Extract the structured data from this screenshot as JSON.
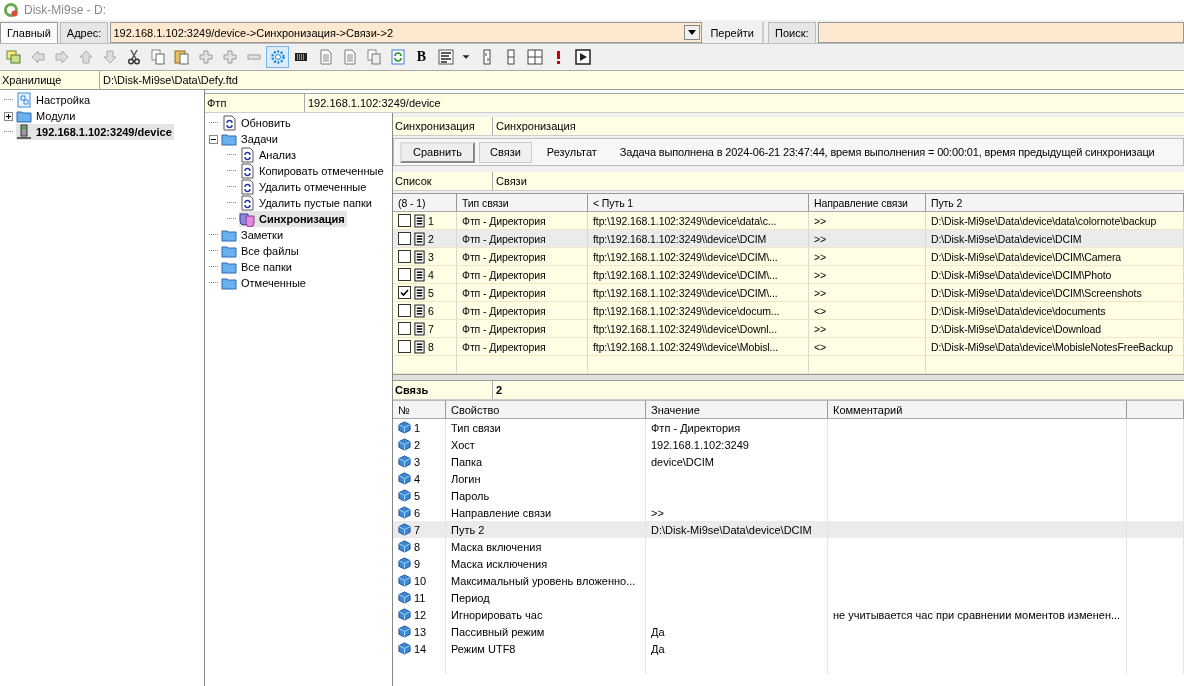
{
  "window": {
    "title": "Disk-Mi9se - D:"
  },
  "tabs": [
    {
      "label": "Главный",
      "selected": true
    }
  ],
  "address": {
    "label": "Адрес:",
    "value": "192.168.1.102:3249/device->Синхронизация->Связи->2"
  },
  "go_button": "Перейти",
  "search": {
    "label": "Поиск:"
  },
  "toolbar": [
    {
      "kind": "new-window",
      "selected": false
    },
    {
      "kind": "back",
      "selected": false
    },
    {
      "kind": "forward",
      "selected": false
    },
    {
      "kind": "up",
      "selected": false
    },
    {
      "kind": "down",
      "selected": false
    },
    {
      "kind": "cut",
      "selected": false
    },
    {
      "kind": "copy",
      "selected": false
    },
    {
      "kind": "paste",
      "selected": false
    },
    {
      "kind": "plus",
      "selected": false
    },
    {
      "kind": "plus",
      "selected": false
    },
    {
      "kind": "minus",
      "selected": false
    },
    {
      "kind": "gear",
      "selected": true
    },
    {
      "kind": "keyboard",
      "selected": false
    },
    {
      "kind": "doc",
      "selected": false
    },
    {
      "kind": "doc",
      "selected": false
    },
    {
      "kind": "doc-copy",
      "selected": false
    },
    {
      "kind": "refresh",
      "selected": false
    },
    {
      "kind": "bold",
      "label": "B",
      "selected": false
    },
    {
      "kind": "align",
      "selected": false
    },
    {
      "kind": "dropdown",
      "selected": false
    },
    {
      "kind": "split-v",
      "selected": false
    },
    {
      "kind": "split-h",
      "selected": false
    },
    {
      "kind": "split-quad",
      "selected": false
    },
    {
      "kind": "alert",
      "selected": false
    },
    {
      "kind": "play",
      "selected": false
    }
  ],
  "storage": {
    "label": "Хранилище",
    "value": "D:\\Disk-Mi9se\\Data\\Defy.ftd"
  },
  "left_tree": [
    {
      "label": "Настройка",
      "kind": "settings",
      "selected": false
    },
    {
      "label": "Модули",
      "kind": "folder",
      "expanded": false,
      "selected": false
    },
    {
      "label": "192.168.1.102:3249/device",
      "kind": "computer",
      "selected": true
    }
  ],
  "middle_header": {
    "label": "Фтп",
    "value": "192.168.1.102:3249/device"
  },
  "middle_tree": [
    {
      "label": "Обновить",
      "kind": "task",
      "selected": false
    },
    {
      "label": "Задачи",
      "kind": "folder",
      "expanded": true,
      "selected": false,
      "children": [
        {
          "label": "Анализ",
          "kind": "task",
          "selected": false
        },
        {
          "label": "Копировать отмеченные",
          "kind": "task",
          "selected": false
        },
        {
          "label": "Удалить отмеченные",
          "kind": "task",
          "selected": false
        },
        {
          "label": "Удалить пустые папки",
          "kind": "task",
          "selected": false
        },
        {
          "label": "Синхронизация",
          "kind": "sync",
          "selected": true
        }
      ]
    },
    {
      "label": "Заметки",
      "kind": "folder",
      "selected": false
    },
    {
      "label": "Все файлы",
      "kind": "folder",
      "selected": false
    },
    {
      "label": "Все папки",
      "kind": "folder",
      "selected": false
    },
    {
      "label": "Отмеченные",
      "kind": "folder",
      "selected": false
    }
  ],
  "task": {
    "label": "Синхронизация",
    "value": "Синхронизация"
  },
  "actions": [
    {
      "kind": "button",
      "label": "Сравнить",
      "selected": false
    },
    {
      "kind": "tab",
      "label": "Связи",
      "selected": true
    },
    {
      "kind": "tab",
      "label": "Результат",
      "selected": false
    }
  ],
  "status": "Задача выполнена в 2024-06-21 23:47:44, время выполнения = 00:00:01, время предыдущей синхронизаци",
  "list": {
    "label": "Список",
    "value": "Связи"
  },
  "links": {
    "columns": [
      "(8 - 1)",
      "Тип связи",
      "< Путь 1",
      "Направление связи",
      "Путь 2"
    ],
    "rows": [
      {
        "checked": false,
        "number": "1",
        "type": "Фтп - Директория",
        "path1": "ftp:\\192.168.1.102:3249\\\\device\\data\\c...",
        "direction": ">>",
        "path2": "D:\\Disk-Mi9se\\Data\\device\\data\\colornote\\backup",
        "selected": false
      },
      {
        "checked": false,
        "number": "2",
        "type": "Фтп - Директория",
        "path1": "ftp:\\192.168.1.102:3249\\\\device\\DCIM",
        "direction": ">>",
        "path2": "D:\\Disk-Mi9se\\Data\\device\\DCIM",
        "selected": true
      },
      {
        "checked": false,
        "number": "3",
        "type": "Фтп - Директория",
        "path1": "ftp:\\192.168.1.102:3249\\\\device\\DCIM\\...",
        "direction": ">>",
        "path2": "D:\\Disk-Mi9se\\Data\\device\\DCIM\\Camera",
        "selected": false
      },
      {
        "checked": false,
        "number": "4",
        "type": "Фтп - Директория",
        "path1": "ftp:\\192.168.1.102:3249\\\\device\\DCIM\\...",
        "direction": ">>",
        "path2": "D:\\Disk-Mi9se\\Data\\device\\DCIM\\Photo",
        "selected": false
      },
      {
        "checked": true,
        "number": "5",
        "type": "Фтп - Директория",
        "path1": "ftp:\\192.168.1.102:3249\\\\device\\DCIM\\...",
        "direction": ">>",
        "path2": "D:\\Disk-Mi9se\\Data\\device\\DCIM\\Screenshots",
        "selected": false
      },
      {
        "checked": false,
        "number": "6",
        "type": "Фтп - Директория",
        "path1": "ftp:\\192.168.1.102:3249\\\\device\\docum...",
        "direction": "<>",
        "path2": "D:\\Disk-Mi9se\\Data\\device\\documents",
        "selected": false
      },
      {
        "checked": false,
        "number": "7",
        "type": "Фтп - Директория",
        "path1": "ftp:\\192.168.1.102:3249\\\\device\\Downl...",
        "direction": ">>",
        "path2": "D:\\Disk-Mi9se\\Data\\device\\Download",
        "selected": false
      },
      {
        "checked": false,
        "number": "8",
        "type": "Фтп - Директория",
        "path1": "ftp:\\192.168.1.102:3249\\\\device\\Mobisl...",
        "direction": "<>",
        "path2": "D:\\Disk-Mi9se\\Data\\device\\MobisleNotesFreeBackup",
        "selected": false
      }
    ]
  },
  "link": {
    "label": "Связь",
    "value": "2"
  },
  "properties": {
    "columns": [
      "№",
      "Свойство",
      "Значение",
      "Комментарий"
    ],
    "rows": [
      {
        "number": "1",
        "property": "Тип связи",
        "value": "Фтп - Директория",
        "selected": false
      },
      {
        "number": "2",
        "property": "Хост",
        "value": "192.168.1.102:3249",
        "selected": false
      },
      {
        "number": "3",
        "property": "Папка",
        "value": "device\\DCIM",
        "selected": false
      },
      {
        "number": "4",
        "property": "Логин",
        "selected": false
      },
      {
        "number": "5",
        "property": "Пароль",
        "selected": false
      },
      {
        "number": "6",
        "property": "Направление связи",
        "value": ">>",
        "selected": false
      },
      {
        "number": "7",
        "property": "Путь 2",
        "value": "D:\\Disk-Mi9se\\Data\\device\\DCIM",
        "selected": true
      },
      {
        "number": "8",
        "property": "Маска включения",
        "selected": false
      },
      {
        "number": "9",
        "property": "Маска исключения",
        "selected": false
      },
      {
        "number": "10",
        "property": "Максимальный уровень вложенно...",
        "selected": false
      },
      {
        "number": "11",
        "property": "Период",
        "selected": false
      },
      {
        "number": "12",
        "property": "Игнорировать час",
        "comment": "не учитывается час при сравнении моментов изменен...",
        "selected": false
      },
      {
        "number": "13",
        "property": "Пассивный режим",
        "value": "Да",
        "selected": false
      },
      {
        "number": "14",
        "property": "Режим UTF8",
        "value": "Да",
        "selected": false
      }
    ]
  }
}
